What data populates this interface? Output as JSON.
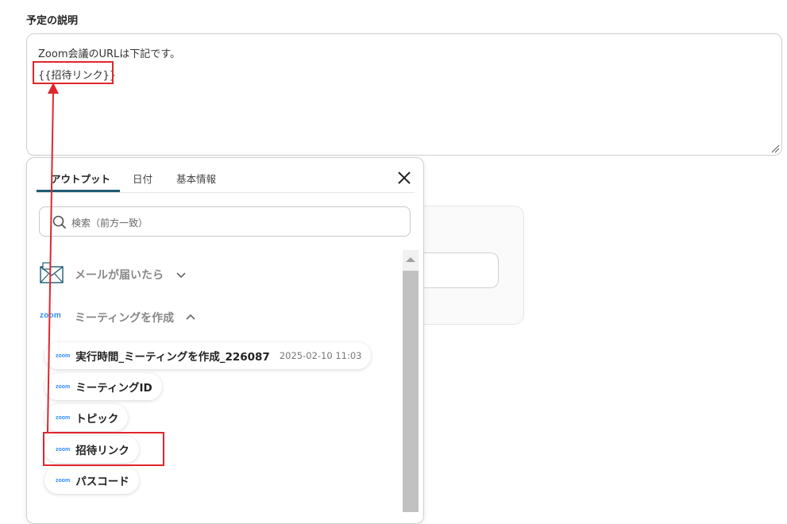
{
  "field": {
    "label": "予定の説明",
    "text_line1": "Zoom会議のURLは下記です。",
    "text_line2": "{{招待リンク}}"
  },
  "popup": {
    "tabs": [
      {
        "label": "アウトプット",
        "active": true
      },
      {
        "label": "日付",
        "active": false
      },
      {
        "label": "基本情報",
        "active": false
      }
    ],
    "close_icon": "close-icon",
    "search": {
      "placeholder": "検索（前方一致）",
      "value": ""
    },
    "groups": [
      {
        "label": "メールが届いたら",
        "icon": "mail-icon",
        "expanded": false
      },
      {
        "label": "ミーティングを作成",
        "icon": "zoom-logo",
        "expanded": true
      }
    ],
    "zoom_logo_text": "zoom",
    "items": [
      {
        "label": "実行時間_ミーティングを作成_226087",
        "value": "2025-02-10 11:03"
      },
      {
        "label": "ミーティングID",
        "value": ""
      },
      {
        "label": "トピック",
        "value": ""
      },
      {
        "label": "招待リンク",
        "value": "",
        "highlighted": true
      },
      {
        "label": "パスコード",
        "value": ""
      }
    ]
  },
  "colors": {
    "highlight": "#e0262c",
    "tab_underline": "#1e5c74",
    "zoom_blue": "#2d8cff"
  }
}
